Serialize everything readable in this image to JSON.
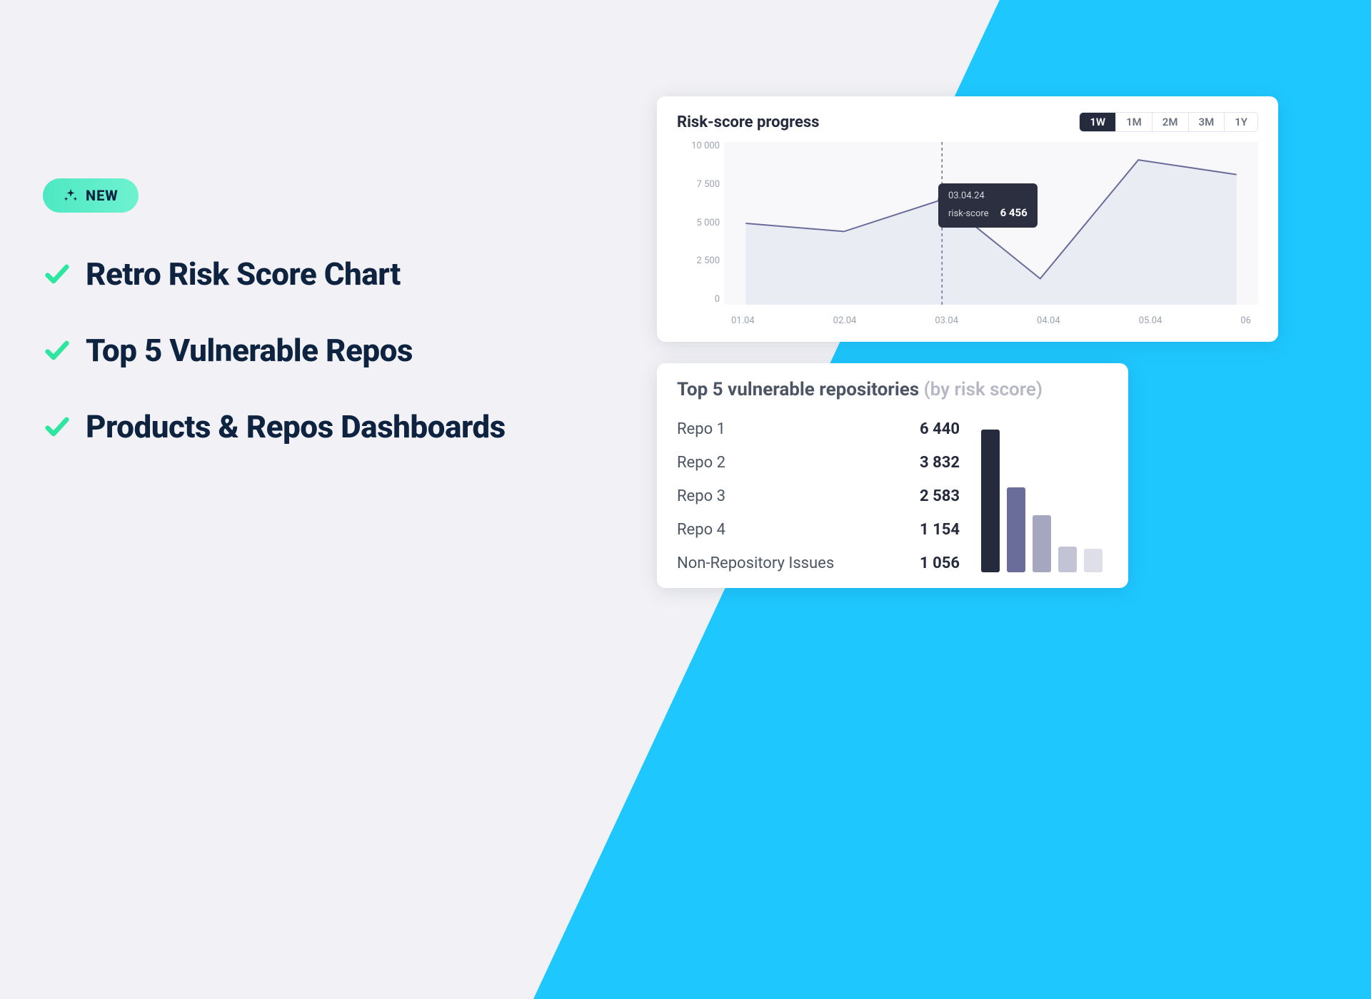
{
  "badge": {
    "label": "NEW"
  },
  "features": {
    "items": [
      {
        "label": "Retro Risk Score Chart"
      },
      {
        "label": "Top 5 Vulnerable Repos"
      },
      {
        "label": "Products & Repos Dashboards"
      }
    ]
  },
  "risk_chart": {
    "title": "Risk-score progress",
    "time_tabs": [
      "1W",
      "1M",
      "2M",
      "3M",
      "1Y"
    ],
    "active_tab": "1W",
    "y_ticks": [
      "10 000",
      "7 500",
      "5 000",
      "2 500",
      "0"
    ],
    "x_ticks": [
      "01.04",
      "02.04",
      "03.04",
      "04.04",
      "05.04",
      "06"
    ],
    "tooltip": {
      "date": "03.04.24",
      "label": "risk-score",
      "value": "6 456"
    }
  },
  "top_repos": {
    "title": "Top 5 vulnerable repositories",
    "subtitle": "(by risk score)",
    "rows": [
      {
        "name": "Repo 1",
        "value": "6 440"
      },
      {
        "name": "Repo 2",
        "value": "3 832"
      },
      {
        "name": "Repo 3",
        "value": "2 583"
      },
      {
        "name": "Repo 4",
        "value": "1 154"
      },
      {
        "name": "Non-Repository Issues",
        "value": "1 056"
      }
    ],
    "bar_colors": [
      "#262a3d",
      "#6a6d9a",
      "#a5a7c0",
      "#c2c4d6",
      "#dedfe8"
    ]
  },
  "colors": {
    "accent_blue": "#1ec8ff",
    "badge_green": "#4de8c2",
    "check_green": "#2ee6a0",
    "text_dark": "#0d2340",
    "card_text": "#262a3d",
    "line": "#6a6d9a"
  },
  "chart_data": [
    {
      "type": "line",
      "title": "Risk-score progress",
      "xlabel": "",
      "ylabel": "",
      "ylim": [
        0,
        10000
      ],
      "x": [
        "01.04",
        "02.04",
        "03.04",
        "04.04",
        "05.04",
        "06.04"
      ],
      "series": [
        {
          "name": "risk-score",
          "values": [
            5000,
            4500,
            6456,
            1600,
            8900,
            8000
          ]
        }
      ],
      "annotations": [
        {
          "x": "03.04",
          "date": "03.04.24",
          "label": "risk-score",
          "value": 6456
        }
      ]
    },
    {
      "type": "bar",
      "title": "Top 5 vulnerable repositories (by risk score)",
      "categories": [
        "Repo 1",
        "Repo 2",
        "Repo 3",
        "Repo 4",
        "Non-Repository Issues"
      ],
      "values": [
        6440,
        3832,
        2583,
        1154,
        1056
      ],
      "ylim": [
        0,
        6440
      ]
    }
  ]
}
